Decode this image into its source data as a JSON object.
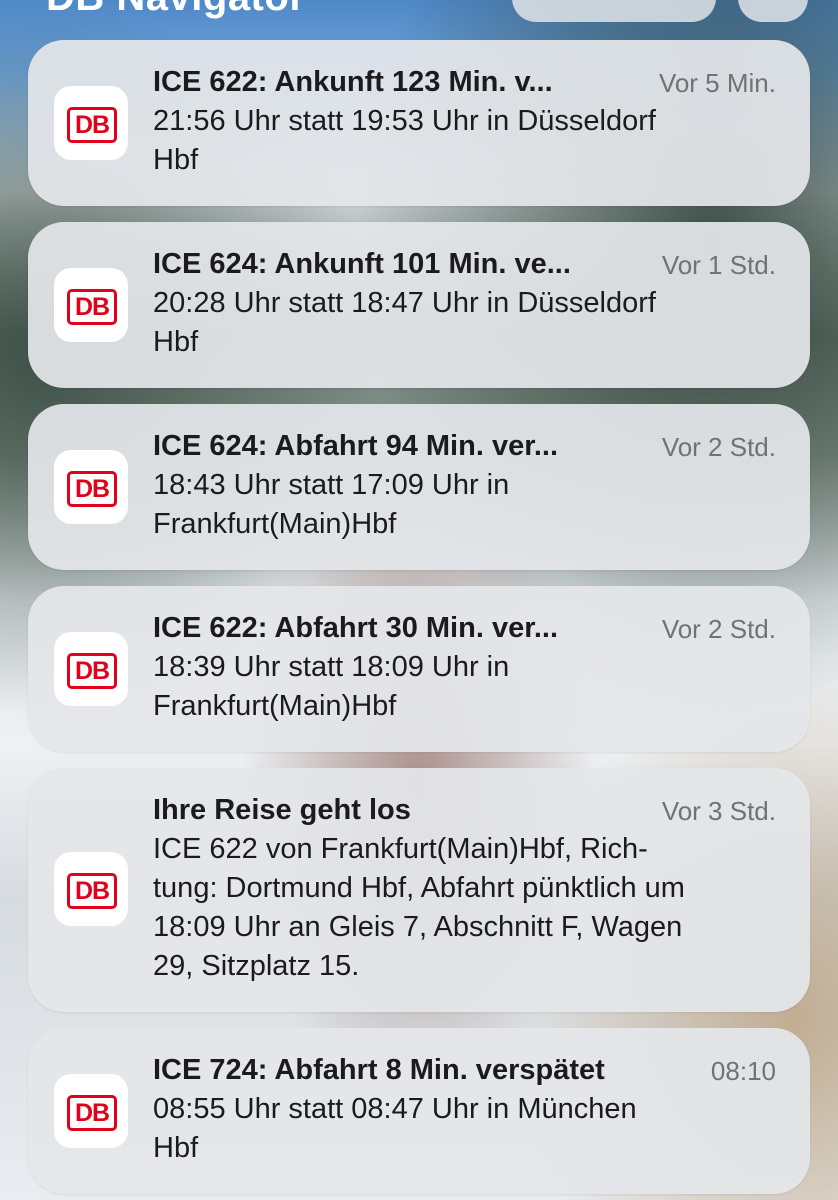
{
  "header": {
    "app_group_title": "DB Navigator"
  },
  "notifications": [
    {
      "title": "ICE 622: Ankunft 123 Min. v...",
      "time": "Vor 5 Min.",
      "body_lines": [
        "21:56 Uhr statt 19:53 Uhr in Düsseldorf",
        "Hbf"
      ]
    },
    {
      "title": "ICE 624: Ankunft 101 Min. ve...",
      "time": "Vor 1 Std.",
      "body_lines": [
        "20:28 Uhr statt 18:47 Uhr in Düsseldorf",
        "Hbf"
      ]
    },
    {
      "title": "ICE 624: Abfahrt 94 Min. ver...",
      "time": "Vor 2 Std.",
      "body_lines": [
        "18:43 Uhr statt 17:09 Uhr in",
        "Frankfurt(Main)Hbf"
      ]
    },
    {
      "title": "ICE 622: Abfahrt 30 Min. ver...",
      "time": "Vor 2 Std.",
      "body_lines": [
        "18:39 Uhr statt 18:09 Uhr in",
        "Frankfurt(Main)Hbf"
      ]
    },
    {
      "title": "Ihre Reise geht los",
      "time": "Vor 3 Std.",
      "body_lines": [
        "ICE 622 von Frankfurt(Main)Hbf, Rich-",
        "tung: Dortmund Hbf, Abfahrt pünktlich um",
        "18:09 Uhr an Gleis 7, Abschnitt F, Wagen",
        "29, Sitzplatz 15."
      ]
    },
    {
      "title": "ICE 724: Abfahrt 8 Min. verspätet",
      "time": "08:10",
      "body_lines": [
        "08:55 Uhr statt 08:47 Uhr in München",
        "Hbf"
      ]
    }
  ],
  "app_icon": {
    "label": "DB",
    "icon_name": "db-logo-icon",
    "brand_color": "#e2001a"
  }
}
